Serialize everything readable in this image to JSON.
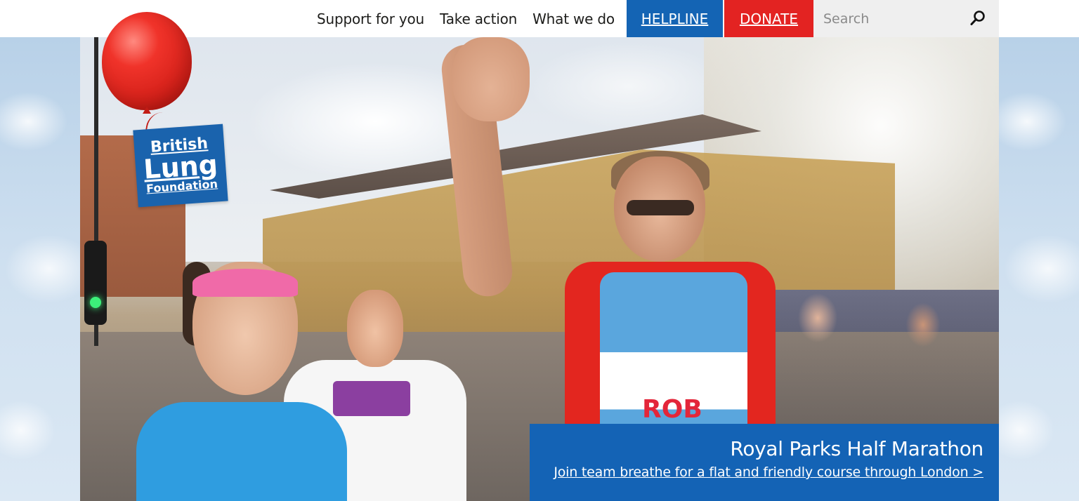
{
  "nav": {
    "items": [
      {
        "label": "Support for you"
      },
      {
        "label": "Take action"
      },
      {
        "label": "What we do"
      }
    ],
    "helpline_label": "HELPLINE",
    "donate_label": "DONATE"
  },
  "search": {
    "placeholder": "Search",
    "icon": "search-icon"
  },
  "logo": {
    "line1": "British",
    "line2": "Lung",
    "line3": "Foundation"
  },
  "hero": {
    "runner_bib_name": "ROB",
    "caption_title": "Royal Parks Half Marathon",
    "caption_link": "Join team breathe for a flat and friendly course through London >"
  },
  "colors": {
    "brand_blue": "#1464b4",
    "donate_red": "#e32322",
    "search_bg": "#efefef"
  }
}
